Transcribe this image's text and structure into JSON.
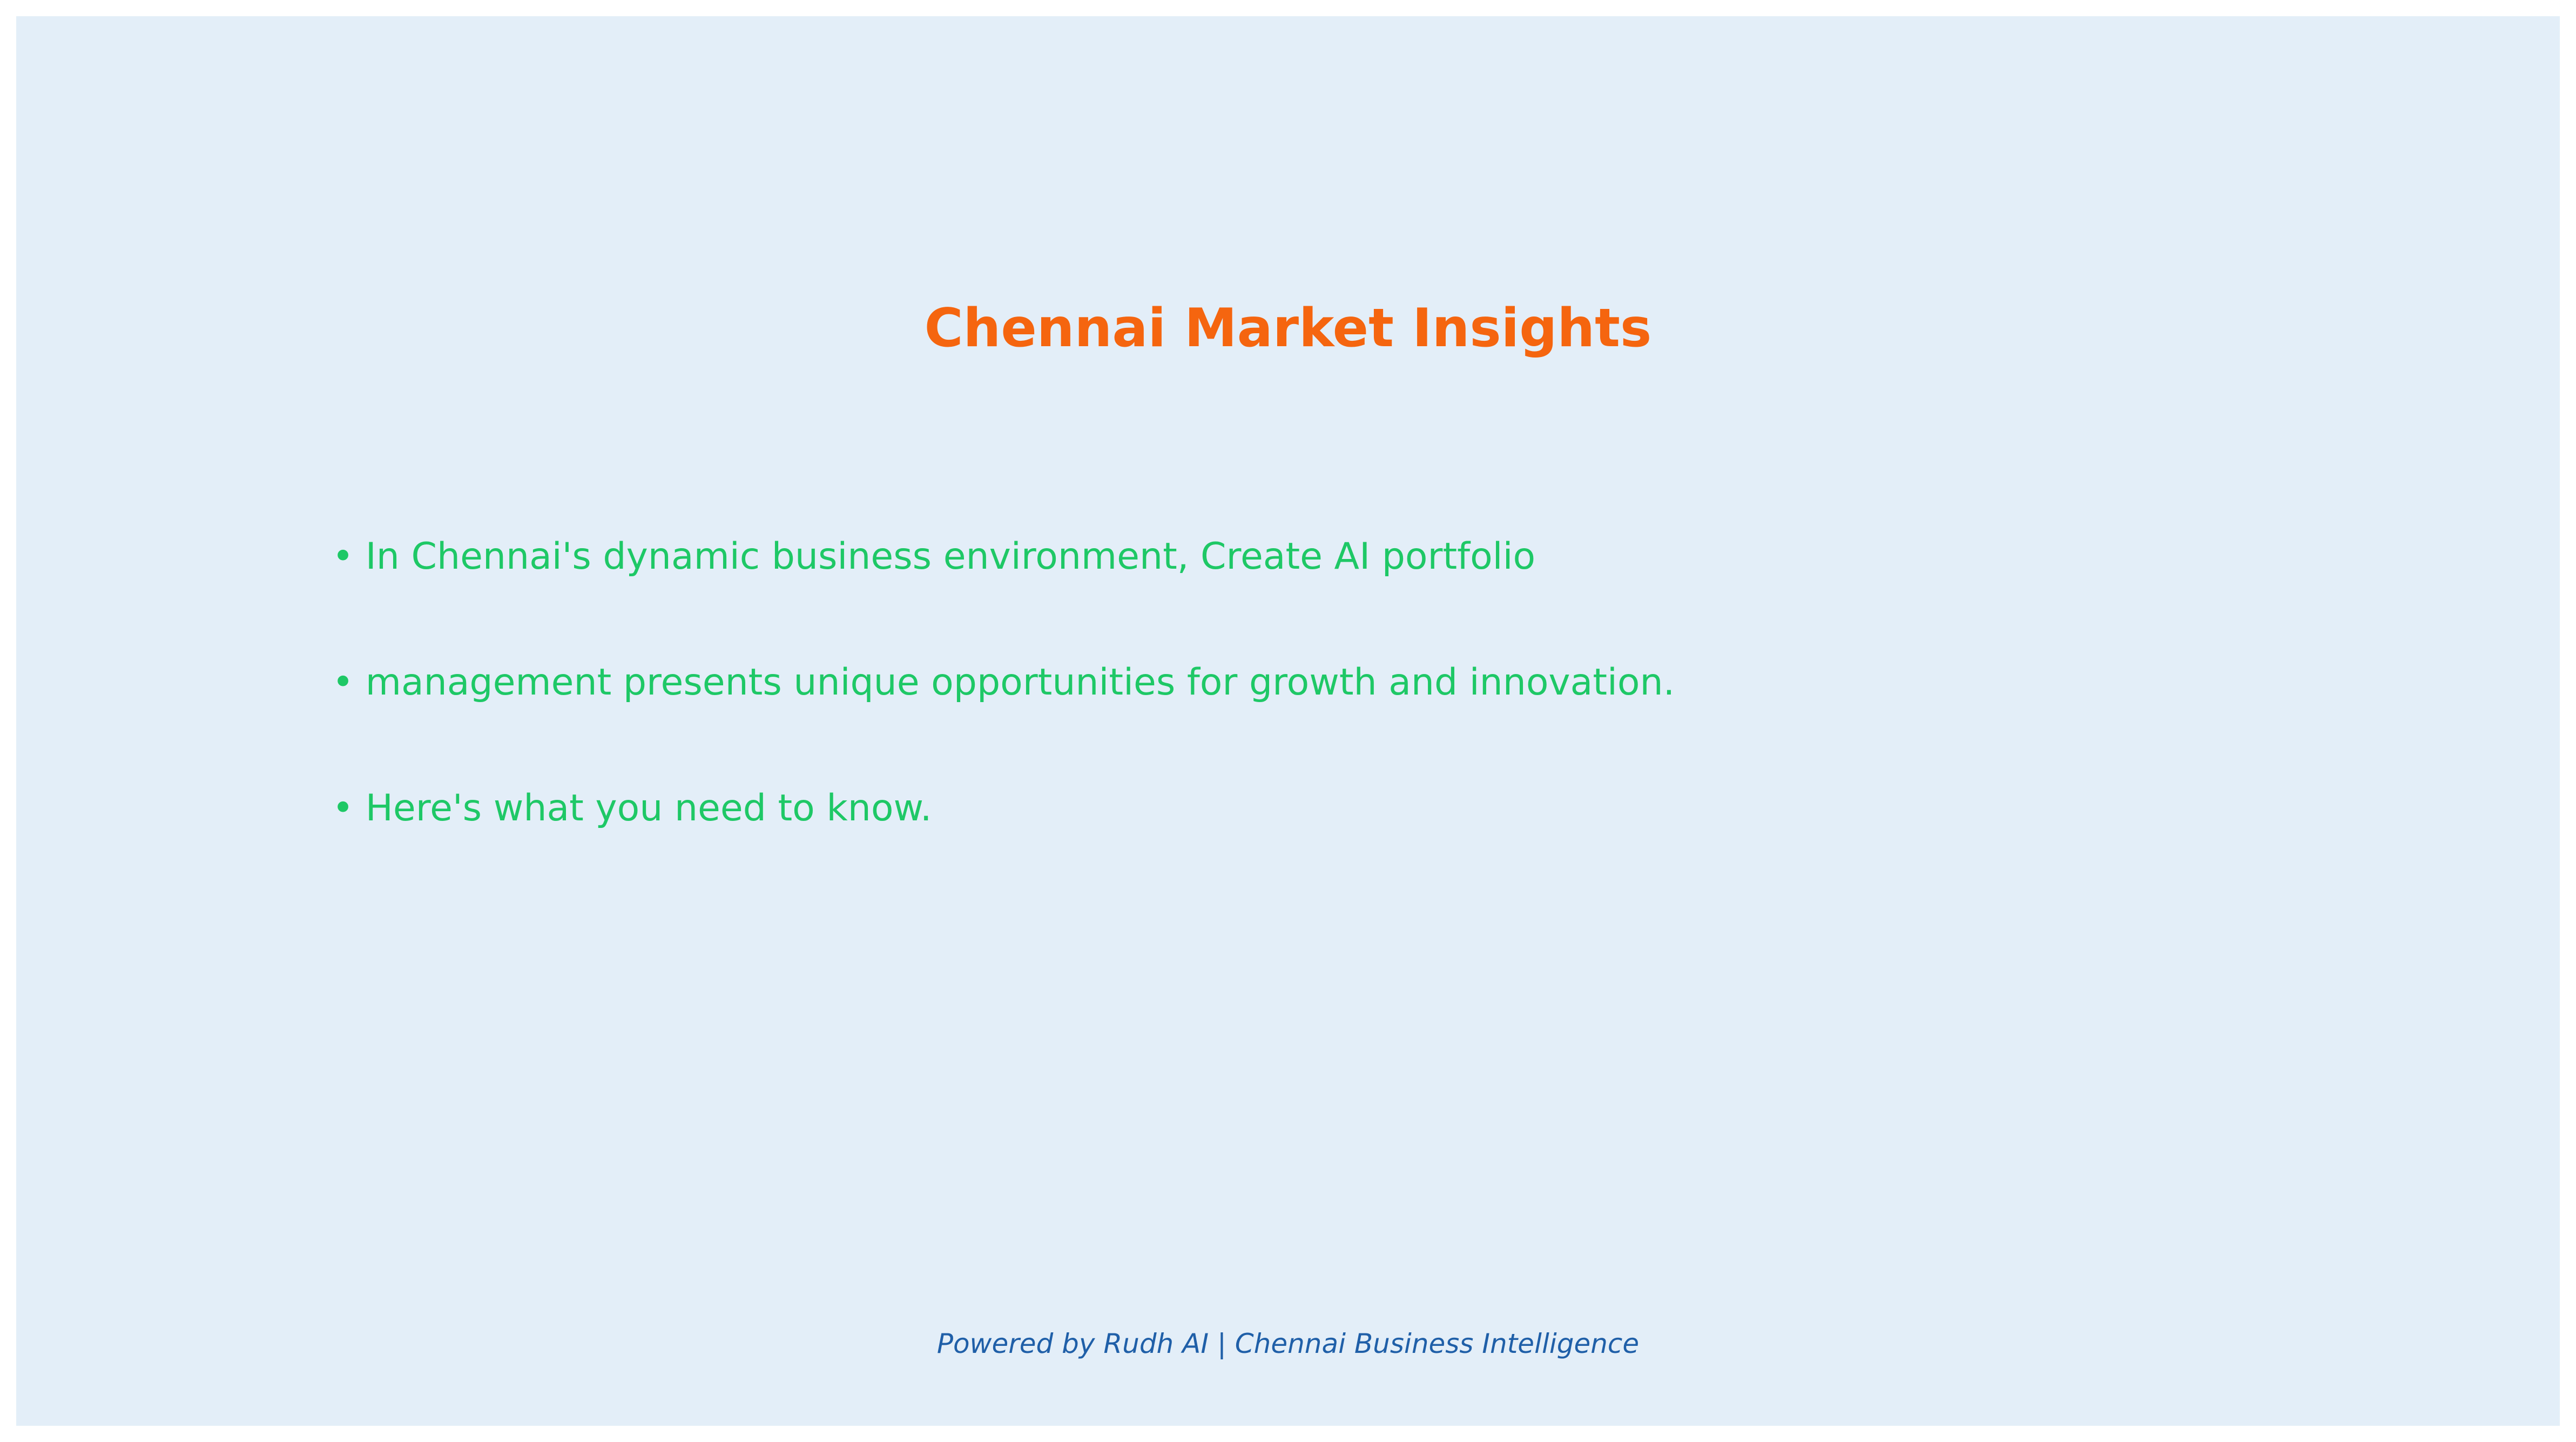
{
  "slide": {
    "title": "Chennai Market Insights",
    "bullets": [
      "• In Chennai's dynamic business environment, Create AI portfolio",
      "• management presents unique opportunities for growth and innovation.",
      "• Here's what you need to know."
    ],
    "footer": "Powered by Rudh AI | Chennai Business Intelligence"
  },
  "colors": {
    "background": "#e3eef8",
    "title": "#f5650f",
    "bullet_text": "#1ec866",
    "footer": "#1f5fa8"
  }
}
